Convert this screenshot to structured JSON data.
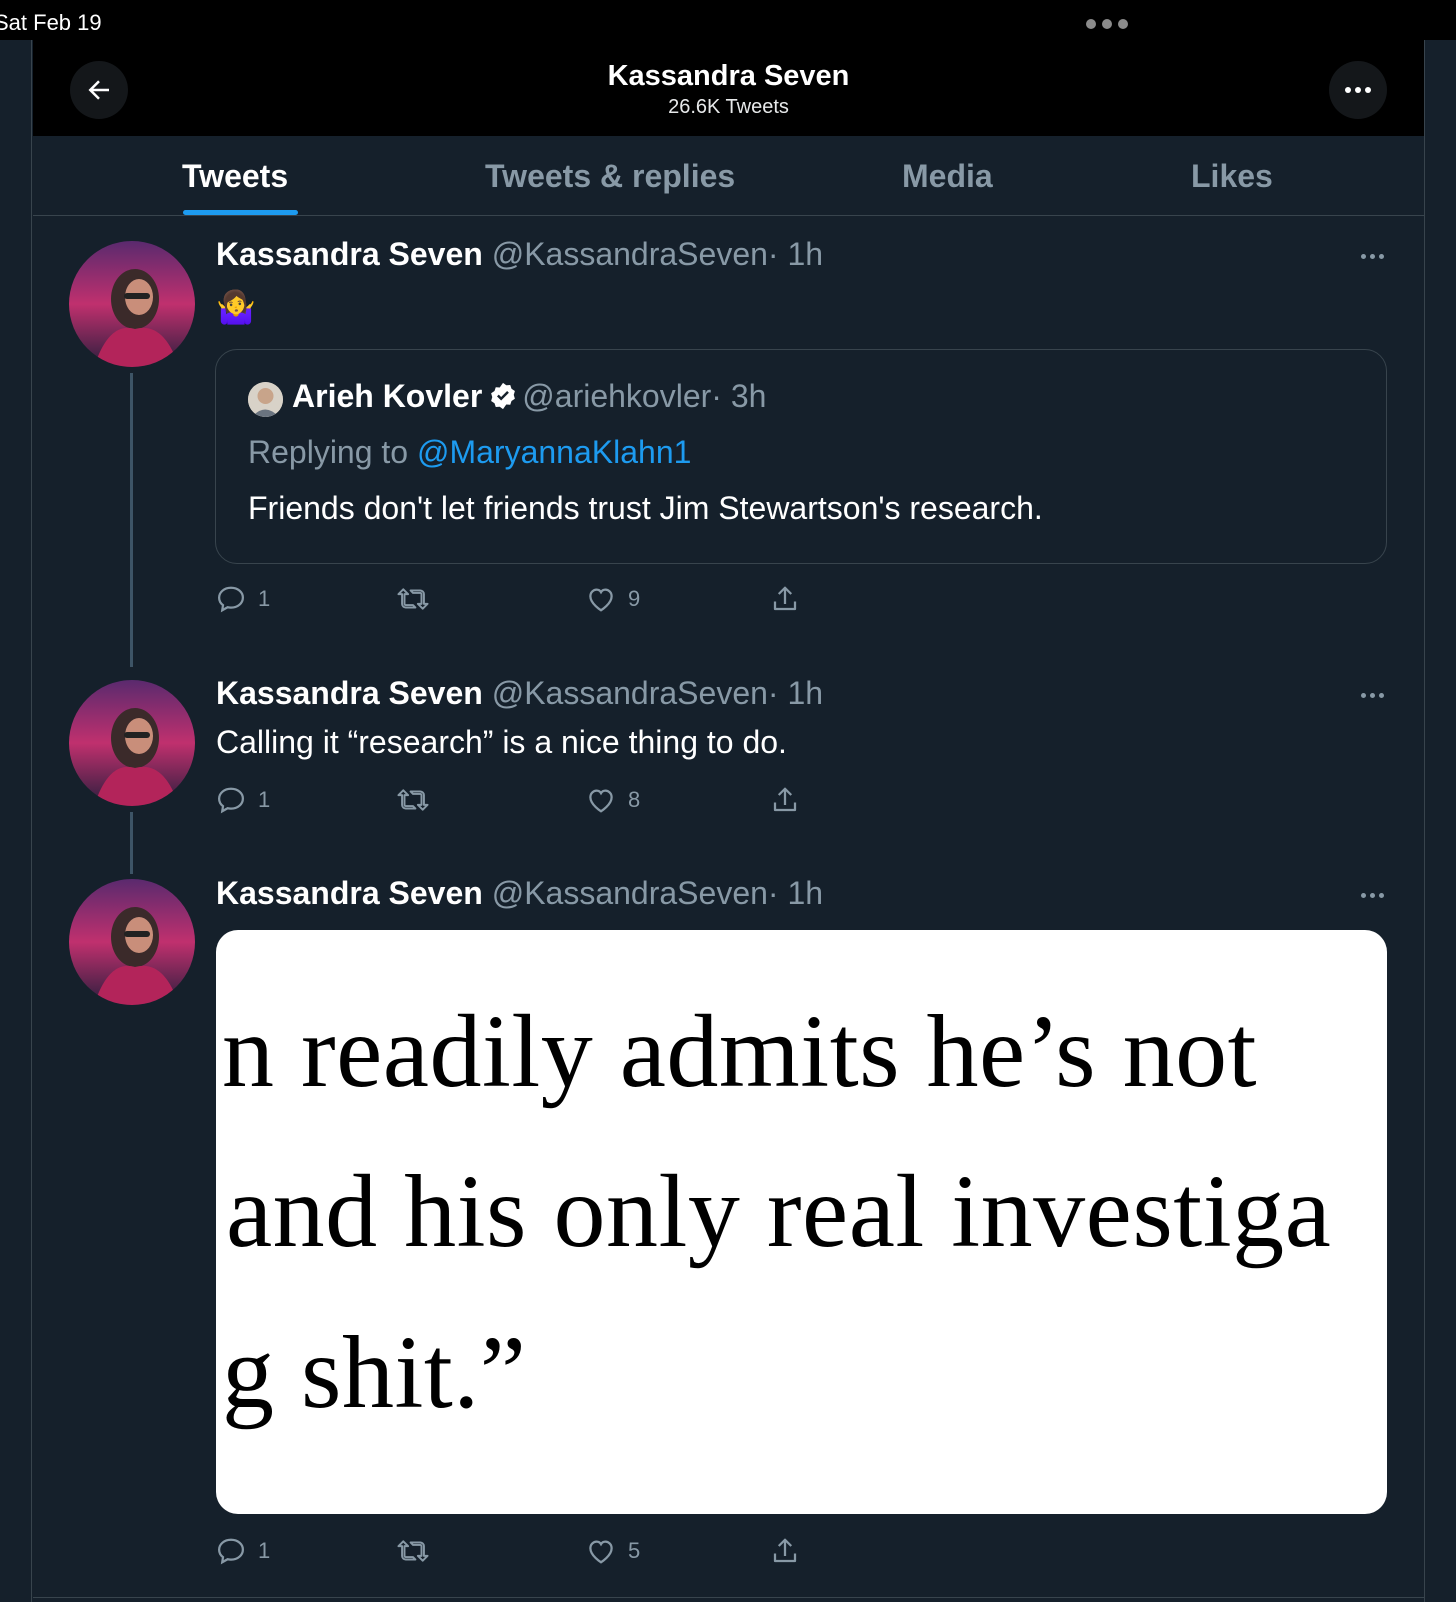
{
  "status_bar": {
    "time": "Sat Feb 19"
  },
  "header": {
    "title": "Kassandra Seven",
    "subtitle": "26.6K Tweets"
  },
  "tabs": [
    {
      "label": "Tweets",
      "active": true
    },
    {
      "label": "Tweets & replies",
      "active": false
    },
    {
      "label": "Media",
      "active": false
    },
    {
      "label": "Likes",
      "active": false
    }
  ],
  "tweets": [
    {
      "name": "Kassandra Seven",
      "handle": "@KassandraSeven",
      "time": "· 1h",
      "text": "🤷‍♀️",
      "quote": {
        "name": "Arieh Kovler",
        "handle": "@ariehkovler",
        "time": "· 3h",
        "replying_prefix": "Replying to ",
        "replying_to": "@MaryannaKlahn1",
        "text": "Friends don't let friends trust Jim Stewartson's research."
      },
      "replies": "1",
      "retweets": "",
      "likes": "9"
    },
    {
      "name": "Kassandra Seven",
      "handle": "@KassandraSeven",
      "time": "· 1h",
      "text": "Calling it “research” is a nice thing to do.",
      "replies": "1",
      "retweets": "",
      "likes": "8"
    },
    {
      "name": "Kassandra Seven",
      "handle": "@KassandraSeven",
      "time": "· 1h",
      "image_text": [
        "n readily admits he’s not",
        "and his only real investiga",
        "g shit.”"
      ],
      "replies": "1",
      "retweets": "",
      "likes": "5"
    }
  ],
  "colors": {
    "accent": "#1d9bf0",
    "background": "#15202b",
    "muted": "#8899a6"
  }
}
